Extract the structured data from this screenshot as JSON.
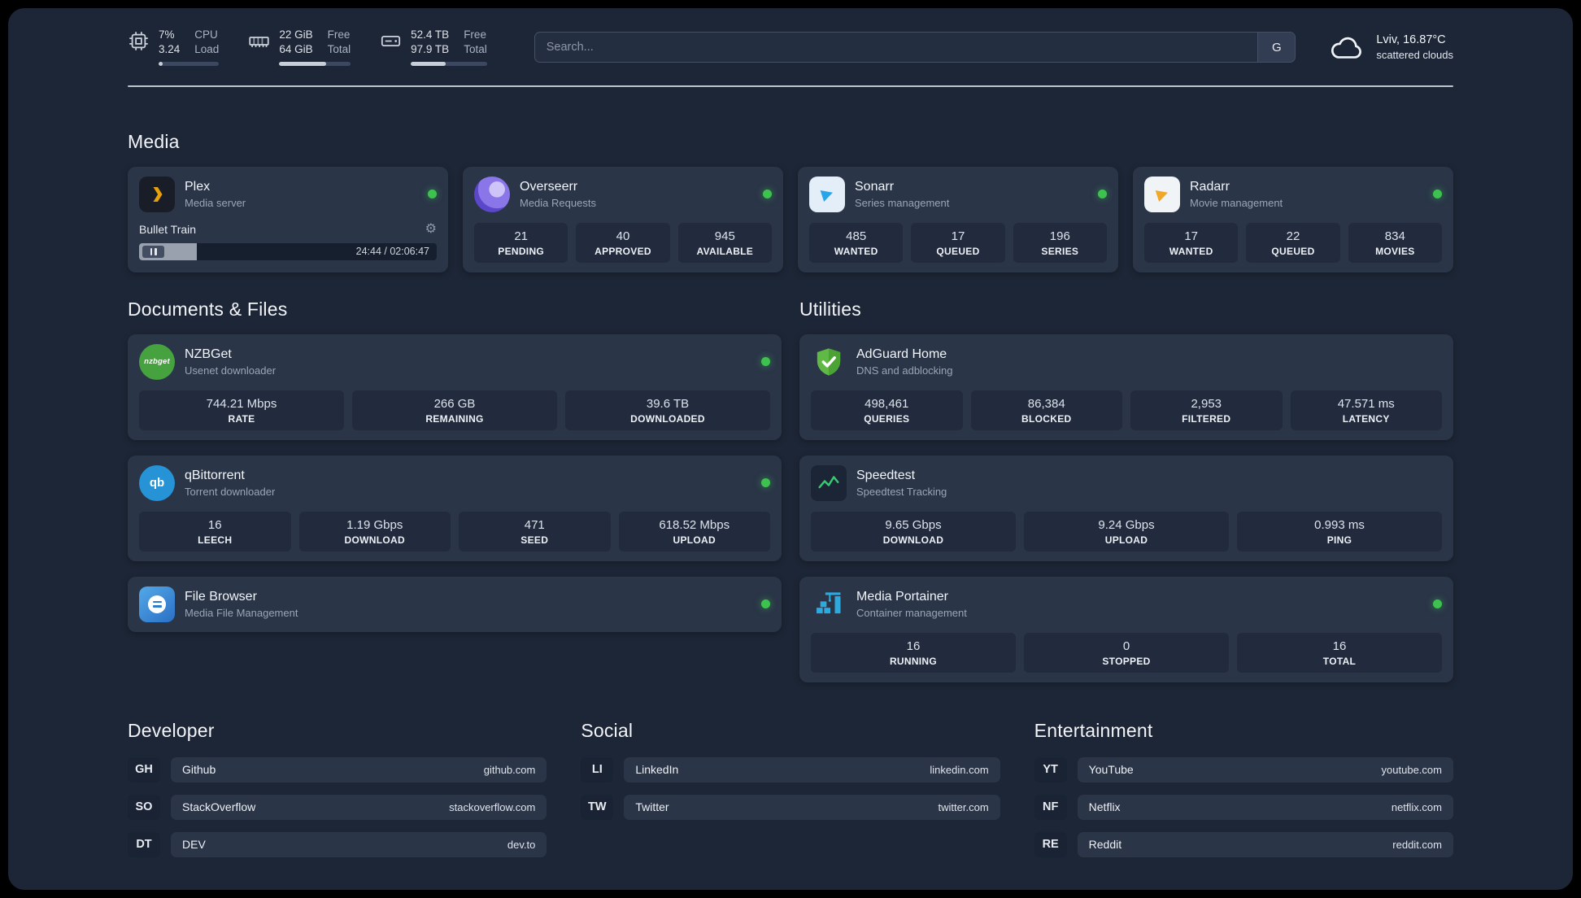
{
  "colors": {
    "background": "#1d2636",
    "card": "#2a3548",
    "tile": "#212b3d",
    "status_online": "#3ec24f",
    "divider": "#cdd2da"
  },
  "icons": {
    "gear": "⚙",
    "nzbget_text": "nzbget",
    "qb_text": "qb"
  },
  "header": {
    "cpu": {
      "line1": "7%",
      "line2": "3.24",
      "lab1": "CPU",
      "lab2": "Load",
      "bar_pct": 7
    },
    "ram": {
      "line1": "22 GiB",
      "line2": "64 GiB",
      "lab1": "Free",
      "lab2": "Total",
      "bar_pct": 66
    },
    "disk": {
      "line1": "52.4 TB",
      "line2": "97.9 TB",
      "lab1": "Free",
      "lab2": "Total",
      "bar_pct": 46
    },
    "search": {
      "placeholder": "Search...",
      "button_label": "G"
    },
    "weather": {
      "location": "Lviv, 16.87°C",
      "condition": "scattered clouds"
    }
  },
  "sections": {
    "media": {
      "title": "Media",
      "plex": {
        "name": "Plex",
        "subtitle": "Media server",
        "now_playing": "Bullet Train",
        "time": "24:44 / 02:06:47",
        "progress_pct": 19.5
      },
      "overseerr": {
        "name": "Overseerr",
        "subtitle": "Media Requests",
        "stats": [
          {
            "value": "21",
            "label": "PENDING"
          },
          {
            "value": "40",
            "label": "APPROVED"
          },
          {
            "value": "945",
            "label": "AVAILABLE"
          }
        ]
      },
      "sonarr": {
        "name": "Sonarr",
        "subtitle": "Series management",
        "stats": [
          {
            "value": "485",
            "label": "WANTED"
          },
          {
            "value": "17",
            "label": "QUEUED"
          },
          {
            "value": "196",
            "label": "SERIES"
          }
        ]
      },
      "radarr": {
        "name": "Radarr",
        "subtitle": "Movie management",
        "stats": [
          {
            "value": "17",
            "label": "WANTED"
          },
          {
            "value": "22",
            "label": "QUEUED"
          },
          {
            "value": "834",
            "label": "MOVIES"
          }
        ]
      }
    },
    "documents": {
      "title": "Documents & Files",
      "nzbget": {
        "name": "NZBGet",
        "subtitle": "Usenet downloader",
        "stats": [
          {
            "value": "744.21 Mbps",
            "label": "RATE"
          },
          {
            "value": "266 GB",
            "label": "REMAINING"
          },
          {
            "value": "39.6 TB",
            "label": "DOWNLOADED"
          }
        ]
      },
      "qbittorrent": {
        "name": "qBittorrent",
        "subtitle": "Torrent downloader",
        "stats": [
          {
            "value": "16",
            "label": "LEECH"
          },
          {
            "value": "1.19 Gbps",
            "label": "DOWNLOAD"
          },
          {
            "value": "471",
            "label": "SEED"
          },
          {
            "value": "618.52 Mbps",
            "label": "UPLOAD"
          }
        ]
      },
      "filebrowser": {
        "name": "File Browser",
        "subtitle": "Media File Management"
      }
    },
    "utilities": {
      "title": "Utilities",
      "adguard": {
        "name": "AdGuard Home",
        "subtitle": "DNS and adblocking",
        "stats": [
          {
            "value": "498,461",
            "label": "QUERIES"
          },
          {
            "value": "86,384",
            "label": "BLOCKED"
          },
          {
            "value": "2,953",
            "label": "FILTERED"
          },
          {
            "value": "47.571 ms",
            "label": "LATENCY"
          }
        ]
      },
      "speedtest": {
        "name": "Speedtest",
        "subtitle": "Speedtest Tracking",
        "stats": [
          {
            "value": "9.65 Gbps",
            "label": "DOWNLOAD"
          },
          {
            "value": "9.24 Gbps",
            "label": "UPLOAD"
          },
          {
            "value": "0.993 ms",
            "label": "PING"
          }
        ]
      },
      "portainer": {
        "name": "Media Portainer",
        "subtitle": "Container management",
        "stats": [
          {
            "value": "16",
            "label": "RUNNING"
          },
          {
            "value": "0",
            "label": "STOPPED"
          },
          {
            "value": "16",
            "label": "TOTAL"
          }
        ]
      }
    },
    "bookmarks": {
      "developer": {
        "title": "Developer",
        "items": [
          {
            "abbr": "GH",
            "name": "Github",
            "url": "github.com"
          },
          {
            "abbr": "SO",
            "name": "StackOverflow",
            "url": "stackoverflow.com"
          },
          {
            "abbr": "DT",
            "name": "DEV",
            "url": "dev.to"
          }
        ]
      },
      "social": {
        "title": "Social",
        "items": [
          {
            "abbr": "LI",
            "name": "LinkedIn",
            "url": "linkedin.com"
          },
          {
            "abbr": "TW",
            "name": "Twitter",
            "url": "twitter.com"
          }
        ]
      },
      "entertainment": {
        "title": "Entertainment",
        "items": [
          {
            "abbr": "YT",
            "name": "YouTube",
            "url": "youtube.com"
          },
          {
            "abbr": "NF",
            "name": "Netflix",
            "url": "netflix.com"
          },
          {
            "abbr": "RE",
            "name": "Reddit",
            "url": "reddit.com"
          }
        ]
      }
    }
  }
}
